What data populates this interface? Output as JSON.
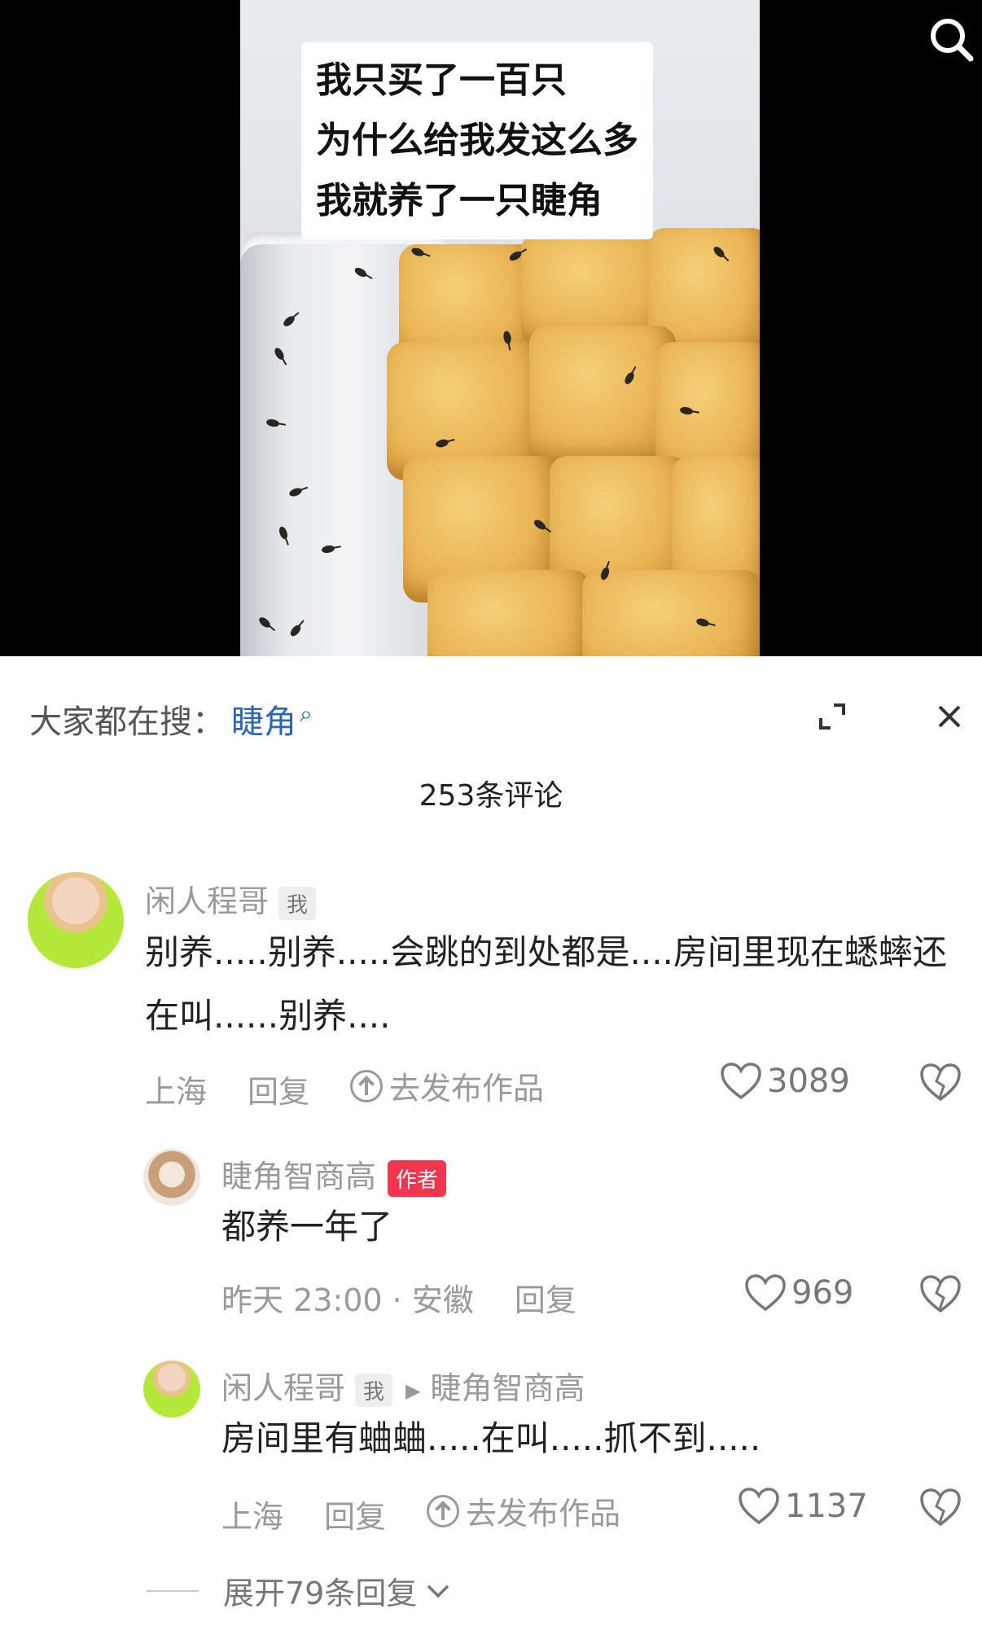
{
  "video": {
    "caption_lines": [
      "我只买了一百只",
      "为什么给我发这么多",
      "我就养了一只睫角"
    ]
  },
  "sheet": {
    "trending_prefix": "大家都在搜：",
    "trending_term": "睫角",
    "comment_count": "253条评论",
    "expand_replies": "展开79条回复"
  },
  "comments": [
    {
      "user": "闲人程哥",
      "badge": "我",
      "text": "别养.....别养.....会跳的到处都是....房间里现在蟋蟀还在叫......别养....",
      "meta_location": "上海",
      "meta_reply": "回复",
      "meta_publish": "去发布作品",
      "likes": "3089"
    },
    {
      "user": "睫角智商高",
      "badge": "作者",
      "text": "都养一年了",
      "meta_time": "昨天 23:00 · 安徽",
      "meta_reply": "回复",
      "likes": "969"
    },
    {
      "user": "闲人程哥",
      "badge": "我",
      "reply_to": "睫角智商高",
      "text": "房间里有蛐蛐.....在叫.....抓不到.....",
      "meta_location": "上海",
      "meta_reply": "回复",
      "meta_publish": "去发布作品",
      "likes": "1137"
    }
  ],
  "icons": {
    "search": "search-icon",
    "expand": "expand-icon",
    "close": "close-icon",
    "heart": "heart-icon",
    "broken_heart": "broken-heart-icon",
    "publish": "upload-circle-icon",
    "chevron": "chevron-down-icon"
  },
  "colors": {
    "link_blue": "#2b66b5",
    "author_red": "#f0364f",
    "muted_gray": "#9a9a9a"
  }
}
